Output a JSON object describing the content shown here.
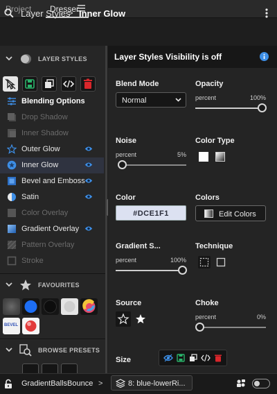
{
  "tabs": {
    "project": "Project",
    "dresser": "Dresser"
  },
  "header": {
    "crumb1": "Layer Styles",
    "separator": ">",
    "crumb2": "Inner Glow"
  },
  "sections": {
    "layer_styles": "LAYER STYLES",
    "favourites": "FAVOURITES",
    "browse_presets": "BROWSE PRESETS"
  },
  "layer_styles": [
    {
      "label": "Blending Options",
      "icon": "sliders-icon",
      "state": "bold"
    },
    {
      "label": "Drop Shadow",
      "icon": "drop-shadow-icon",
      "state": "dim"
    },
    {
      "label": "Inner Shadow",
      "icon": "inner-shadow-icon",
      "state": "dim"
    },
    {
      "label": "Outer Glow",
      "icon": "star-outline-icon",
      "state": "on"
    },
    {
      "label": "Inner Glow",
      "icon": "star-filled-icon",
      "state": "selected"
    },
    {
      "label": "Bevel and Emboss",
      "icon": "bevel-icon",
      "state": "on"
    },
    {
      "label": "Satin",
      "icon": "satin-icon",
      "state": "on"
    },
    {
      "label": "Color Overlay",
      "icon": "color-overlay-icon",
      "state": "dim"
    },
    {
      "label": "Gradient Overlay",
      "icon": "gradient-overlay-icon",
      "state": "on"
    },
    {
      "label": "Pattern Overlay",
      "icon": "pattern-overlay-icon",
      "state": "dim"
    },
    {
      "label": "Stroke",
      "icon": "stroke-icon",
      "state": "dim"
    }
  ],
  "favourite_swatches": [
    "#555555",
    "#1d6ef5",
    "#101010",
    "#d9d9d9",
    "rainbow",
    "BEVEL",
    "#e23b3b"
  ],
  "visibility": {
    "text": "Layer Styles Visibility is off"
  },
  "blend_mode": {
    "label": "Blend Mode",
    "value": "Normal"
  },
  "opacity": {
    "label": "Opacity",
    "unit": "percent",
    "value": "100%",
    "fraction": 1.0
  },
  "noise": {
    "label": "Noise",
    "unit": "percent",
    "value": "5%",
    "fraction": 0.05
  },
  "color_type": {
    "label": "Color Type"
  },
  "color": {
    "label": "Color",
    "hex": "#DCE1F1"
  },
  "colors": {
    "label": "Colors",
    "button": "Edit Colors"
  },
  "gradient_smoothness": {
    "label": "Gradient S...",
    "unit": "percent",
    "value": "100%",
    "fraction": 1.0
  },
  "technique": {
    "label": "Technique"
  },
  "source": {
    "label": "Source"
  },
  "choke": {
    "label": "Choke",
    "unit": "percent",
    "value": "0%",
    "fraction": 0.0
  },
  "size": {
    "label": "Size"
  },
  "bottom": {
    "document": "GradientBallsBounce",
    "chevron": ">",
    "layer": "8: blue-lowerRi..."
  },
  "colors_theme": {
    "accent": "#3d8ee6",
    "delete": "#d9262b",
    "save": "#2ab36a"
  }
}
